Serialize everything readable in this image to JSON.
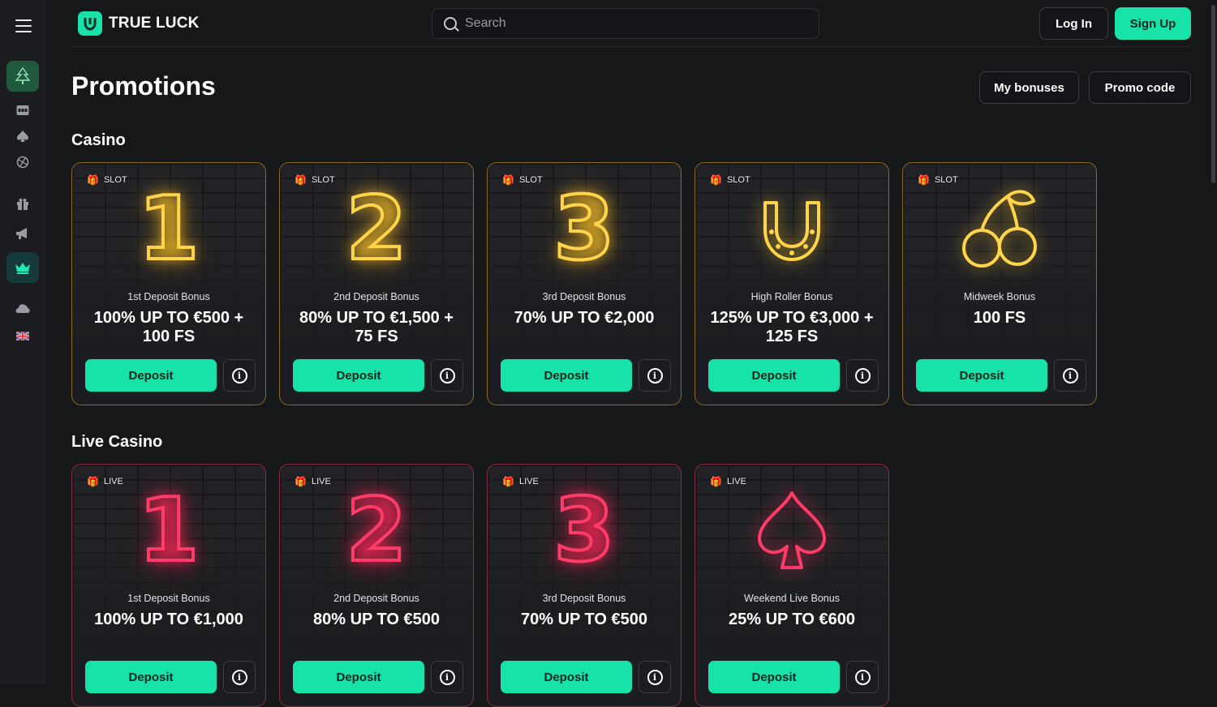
{
  "brand": {
    "name": "TRUE LUCK"
  },
  "header": {
    "search_placeholder": "Search",
    "login_label": "Log In",
    "signup_label": "Sign Up"
  },
  "rail": {
    "icons": [
      "menu-icon",
      "tree-icon",
      "slot-machine-icon",
      "spade-icon",
      "sports-ball-icon",
      "gift-icon",
      "megaphone-icon",
      "crown-icon",
      "cloud-icon",
      "uk-flag-icon"
    ]
  },
  "page": {
    "title": "Promotions",
    "my_bonuses_label": "My bonuses",
    "promo_code_label": "Promo code"
  },
  "colors": {
    "accent": "#17e3a9",
    "gold_neon": "#ffd44a",
    "pink_neon": "#ff3b67",
    "background": "#161719"
  },
  "sections": [
    {
      "title": "Casino",
      "cards": [
        {
          "tag": "SLOT",
          "art": "1",
          "subtitle": "1st Deposit Bonus",
          "amount": "100% UP TO €500 + 100 FS",
          "button": "Deposit"
        },
        {
          "tag": "SLOT",
          "art": "2",
          "subtitle": "2nd Deposit Bonus",
          "amount": "80% UP TO €1,500 + 75 FS",
          "button": "Deposit"
        },
        {
          "tag": "SLOT",
          "art": "3",
          "subtitle": "3rd Deposit Bonus",
          "amount": "70% UP TO €2,000",
          "button": "Deposit"
        },
        {
          "tag": "SLOT",
          "art": "horseshoe",
          "subtitle": "High Roller Bonus",
          "amount": "125% UP TO €3,000 + 125 FS",
          "button": "Deposit"
        },
        {
          "tag": "SLOT",
          "art": "cherries",
          "subtitle": "Midweek Bonus",
          "amount": "100 FS",
          "button": "Deposit"
        }
      ]
    },
    {
      "title": "Live Casino",
      "cards": [
        {
          "tag": "LIVE",
          "art": "1",
          "subtitle": "1st Deposit Bonus",
          "amount": "100% UP TO €1,000",
          "button": "Deposit"
        },
        {
          "tag": "LIVE",
          "art": "2",
          "subtitle": "2nd Deposit Bonus",
          "amount": "80% UP TO €500",
          "button": "Deposit"
        },
        {
          "tag": "LIVE",
          "art": "3",
          "subtitle": "3rd Deposit Bonus",
          "amount": "70% UP TO €500",
          "button": "Deposit"
        },
        {
          "tag": "LIVE",
          "art": "spade",
          "subtitle": "Weekend Live Bonus",
          "amount": "25% UP TO €600",
          "button": "Deposit"
        }
      ]
    }
  ]
}
